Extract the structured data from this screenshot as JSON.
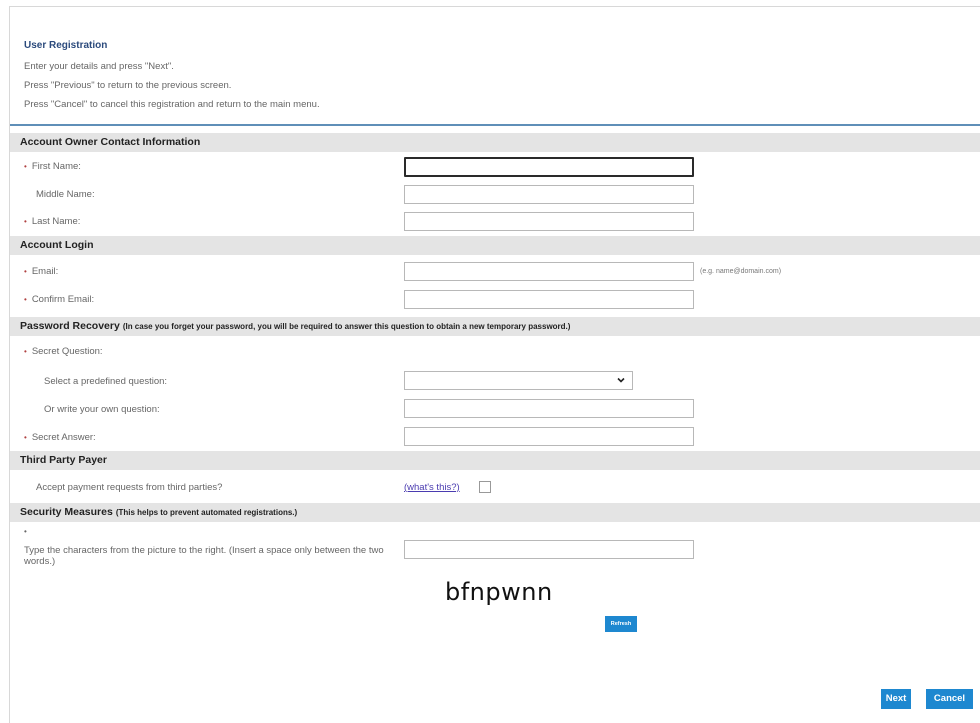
{
  "intro": {
    "title": "User Registration",
    "line1": "Enter your details and press \"Next\".",
    "line2": "Press \"Previous\" to return to the previous screen.",
    "line3": "Press \"Cancel\" to cancel this registration and return to the main menu."
  },
  "sections": {
    "contact": "Account Owner Contact Information",
    "login": "Account Login",
    "recovery": "Password Recovery",
    "recovery_note": "(In case you forget your password, you will be required to answer this question to obtain a new temporary password.)",
    "payer": "Third Party Payer",
    "security": "Security Measures",
    "security_note": "(This helps to prevent automated registrations.)"
  },
  "fields": {
    "first_name": {
      "label": "First Name:",
      "value": ""
    },
    "middle_name": {
      "label": "Middle Name:",
      "value": ""
    },
    "last_name": {
      "label": "Last Name:",
      "value": ""
    },
    "email": {
      "label": "Email:",
      "value": "",
      "hint": "(e.g. name@domain.com)"
    },
    "confirm_email": {
      "label": "Confirm Email:",
      "value": ""
    },
    "secret_question": {
      "label": "Secret Question:"
    },
    "predefined_question": {
      "label": "Select a predefined question:",
      "selected": ""
    },
    "own_question": {
      "label": "Or write your own question:",
      "value": ""
    },
    "secret_answer": {
      "label": "Secret Answer:",
      "value": ""
    },
    "third_party": {
      "label": "Accept payment requests from third parties?",
      "link": "(what's this?)",
      "checked": false
    },
    "captcha_input": {
      "label": "Type the characters from the picture to the right. (Insert a space only between the two words.)",
      "value": ""
    }
  },
  "captcha": {
    "text": "bfnpwnn",
    "refresh_label": "Refresh"
  },
  "buttons": {
    "next": "Next",
    "cancel": "Cancel"
  },
  "required_marker": "•",
  "colors": {
    "accent": "#1e88d0",
    "separator": "#5f8fb8",
    "section_bg": "#e4e4e4",
    "title": "#2b4a7c"
  }
}
